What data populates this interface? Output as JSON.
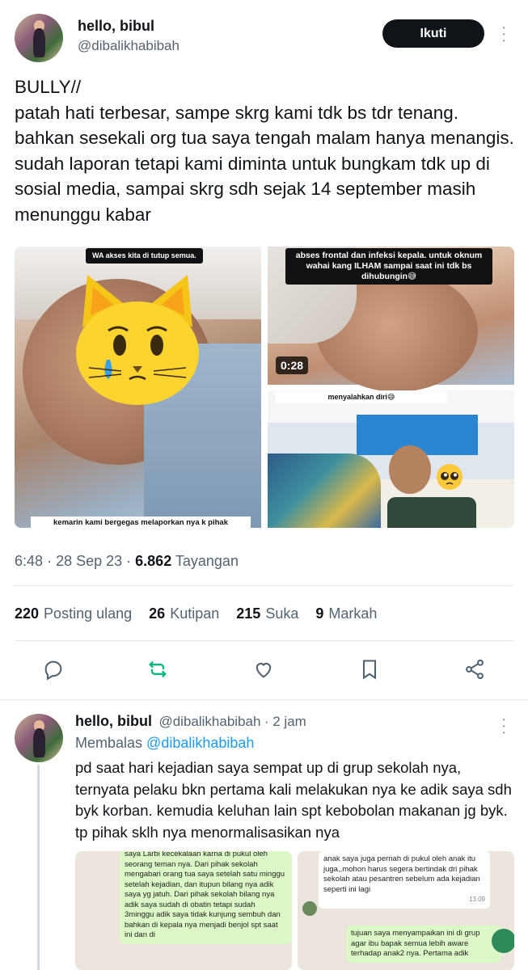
{
  "tweet": {
    "author_name": "hello, bibul",
    "author_handle": "@dibalikhabibah",
    "follow_label": "Ikuti",
    "text": "BULLY//\npatah hati terbesar, sampe skrg kami tdk bs tdr tenang. bahkan sesekali org tua saya tengah malam hanya menangis. sudah laporan tetapi kami diminta untuk bungkam tdk up di sosial media, sampai skrg sdh sejak 14 september masih menunggu kabar",
    "media": {
      "img1_top_caption": "WA akses kita di tutup semua.",
      "img1_bottom_caption": "kemarin kami bergegas melaporkan nya k pihak",
      "img2_caption": "abses frontal dan infeksi kepala. untuk oknum wahai kang ILHAM sampai saat ini tdk bs dihubungin😅",
      "img2_duration": "0:28",
      "img3_caption": "menyalahkan diri😅"
    },
    "time": "6:48",
    "date": "28 Sep 23",
    "views_count": "6.862",
    "views_label": "Tayangan",
    "stats": {
      "reposts_count": "220",
      "reposts_label": "Posting ulang",
      "quotes_count": "26",
      "quotes_label": "Kutipan",
      "likes_count": "215",
      "likes_label": "Suka",
      "bookmarks_count": "9",
      "bookmarks_label": "Markah"
    }
  },
  "reply": {
    "author_name": "hello, bibul",
    "author_handle": "@dibalikhabibah",
    "time": "· 2 jam",
    "replying_prefix": "Membalas",
    "replying_to": "@dibalikhabibah",
    "text": "pd saat hari kejadian saya sempat up di grup sekolah nya, ternyata pelaku bkn pertama kali melakukan nya ke adik saya sdh byk korban. kemudia keluhan lain spt kebobolan makanan jg byk. tp pihak sklh nya menormalisasikan nya",
    "chat_left": "saya Larbi kecekalaan karna di pukul oleh seorang teman nya. Dari pihak sekolah mengabari orang tua saya setelah satu minggu setelah kejadian, dan itupun bilang nya adik saya yg jatuh. Dari pihak sekolah bilang nya adik saya sudah di obatin tetapi sudah 3minggu adik saya tidak kunjung sembuh dan bahkan di kepala nya menjadi benjol spt saat ini dan di",
    "chat_right_1": "anak saya juga pernah di pukul oleh anak itu juga,,mohon harus segera bertindak dri pihak sekolah atau pesantren sebelum ada kejadian seperti ini lagi",
    "chat_right_1_time": "13.09",
    "chat_right_2": "tujuan saya menyampaikan ini di grup agar ibu bapak semua lebih aware terhadap anak2 nya. Pertama adik"
  },
  "colors": {
    "accent": "#1d9bf0",
    "repost_green": "#00ba7c",
    "text": "#0f1419",
    "muted": "#536471"
  }
}
